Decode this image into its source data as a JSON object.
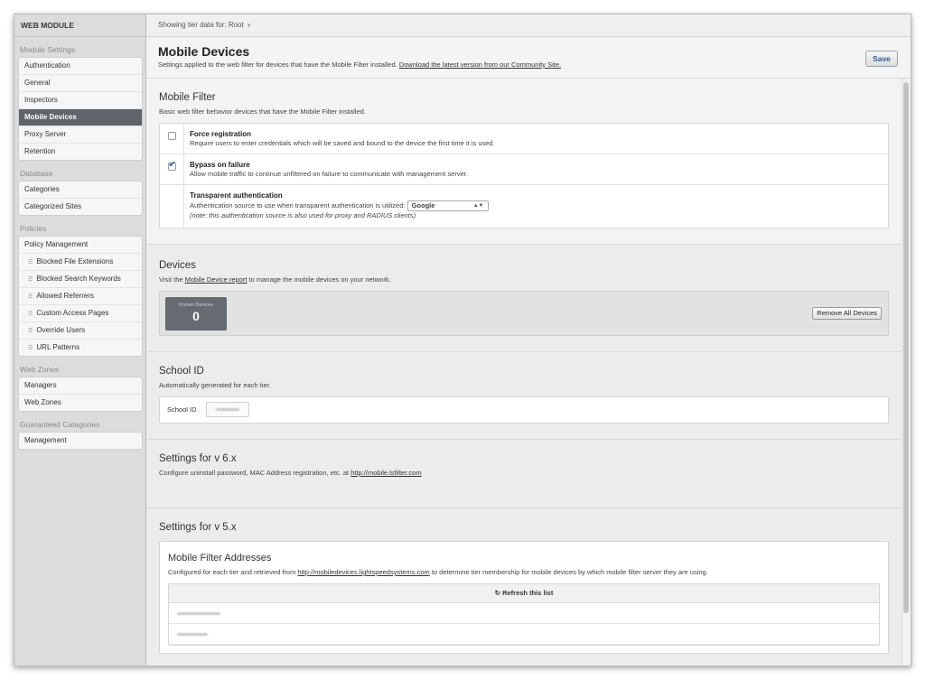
{
  "sidebar": {
    "title": "WEB MODULE",
    "sections": [
      {
        "label": "Module Settings",
        "items": [
          {
            "label": "Authentication",
            "sub": false
          },
          {
            "label": "General",
            "sub": false
          },
          {
            "label": "Inspectors",
            "sub": false
          },
          {
            "label": "Mobile Devices",
            "sub": false,
            "active": true
          },
          {
            "label": "Proxy Server",
            "sub": false
          },
          {
            "label": "Retention",
            "sub": false
          }
        ]
      },
      {
        "label": "Database",
        "items": [
          {
            "label": "Categories",
            "sub": false
          },
          {
            "label": "Categorized Sites",
            "sub": false
          }
        ]
      },
      {
        "label": "Policies",
        "items": [
          {
            "label": "Policy Management",
            "sub": false
          },
          {
            "label": "Blocked File Extensions",
            "sub": true
          },
          {
            "label": "Blocked Search Keywords",
            "sub": true
          },
          {
            "label": "Allowed Referrers",
            "sub": true
          },
          {
            "label": "Custom Access Pages",
            "sub": true
          },
          {
            "label": "Override Users",
            "sub": true
          },
          {
            "label": "URL Patterns",
            "sub": true
          }
        ]
      },
      {
        "label": "Web Zones",
        "items": [
          {
            "label": "Managers",
            "sub": false
          },
          {
            "label": "Web Zones",
            "sub": false
          }
        ]
      },
      {
        "label": "Guaranteed Categories",
        "items": [
          {
            "label": "Management",
            "sub": false
          }
        ]
      }
    ]
  },
  "topbar": {
    "tier_label": "Showing tier data for: Root"
  },
  "page": {
    "title": "Mobile Devices",
    "subtitle": "Settings applied to the web filter for devices that have the Mobile Filter installed.",
    "subtitle_link": "Download the latest version from our Community Site.",
    "save_label": "Save"
  },
  "mobile_filter": {
    "title": "Mobile Filter",
    "desc": "Basic web filter behavior devices that have the Mobile Filter installed.",
    "force": {
      "title": "Force registration",
      "desc": "Require users to enter credentials which will be saved and bound to the device the first time it is used.",
      "checked": false
    },
    "bypass": {
      "title": "Bypass on failure",
      "desc": "Allow mobile traffic to continue unfiltered on failure to communicate with management server.",
      "checked": true
    },
    "transparent": {
      "title": "Transparent authentication",
      "desc": "Authentication source to use when transparent authentication is utilized:",
      "source": "Google",
      "note": "(note: this authentication source is also used for proxy and RADIUS clients)"
    }
  },
  "devices": {
    "title": "Devices",
    "desc_pre": "Visit the",
    "desc_link": "Mobile Device report",
    "desc_post": "to manage the mobile devices on your network.",
    "known_label": "Known Devices",
    "known_count": "0",
    "remove_label": "Remove All Devices"
  },
  "school": {
    "title": "School ID",
    "desc": "Automatically generated for each tier.",
    "field_label": "School ID"
  },
  "v6": {
    "title": "Settings for v 6.x",
    "desc": "Configure uninstall password, MAC Address registration, etc. at",
    "link": "http://mobile.lsfilter.com"
  },
  "v5": {
    "title": "Settings for v 5.x",
    "card_title": "Mobile Filter Addresses",
    "desc_pre": "Configured for each tier and retrieved from",
    "desc_link": "http://mobiledevices.lightspeedsystems.com",
    "desc_post": "to determine tier membership for mobile devices by which mobile filter server they are using.",
    "refresh_label": "Refresh this list"
  }
}
